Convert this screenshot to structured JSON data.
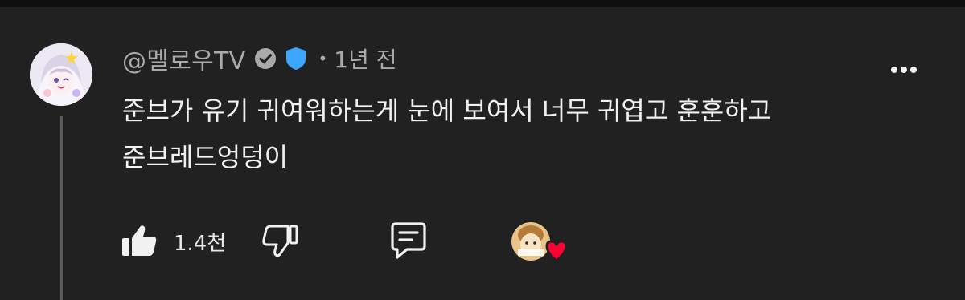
{
  "comment": {
    "author": "@멜로우TV",
    "time": "1년 전",
    "lines": [
      "준브가 유기 귀여워하는게 눈에 보여서 너무 귀엽고 훈훈하고",
      "준브레드엉덩이"
    ],
    "like_count": "1.4천"
  },
  "icons": {
    "verified": "verified-check-icon",
    "badge": "shield-badge-icon",
    "like": "thumbs-up-icon",
    "dislike": "thumbs-down-icon",
    "reply": "comment-icon",
    "more": "more-vertical-icon",
    "hearted": "creator-heart-icon"
  },
  "colors": {
    "background": "#212121",
    "text_primary": "#f1f1f1",
    "text_secondary": "#aaaaaa",
    "badge_blue": "#3ea6ff",
    "heart_red": "#ff0033"
  }
}
